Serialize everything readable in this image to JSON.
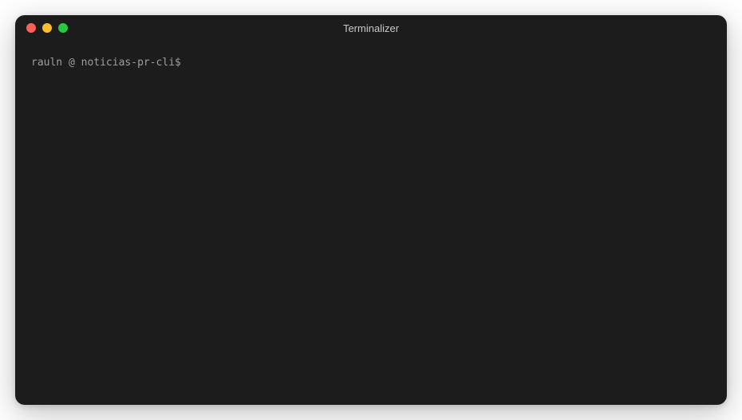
{
  "window": {
    "title": "Terminalizer",
    "controls": {
      "close_color": "#ff5f57",
      "minimize_color": "#febc2e",
      "maximize_color": "#28c840"
    }
  },
  "terminal": {
    "prompt": {
      "user": "rauln",
      "at": " @ ",
      "host": "noticias-pr-cli",
      "symbol": "$",
      "command": ""
    }
  }
}
